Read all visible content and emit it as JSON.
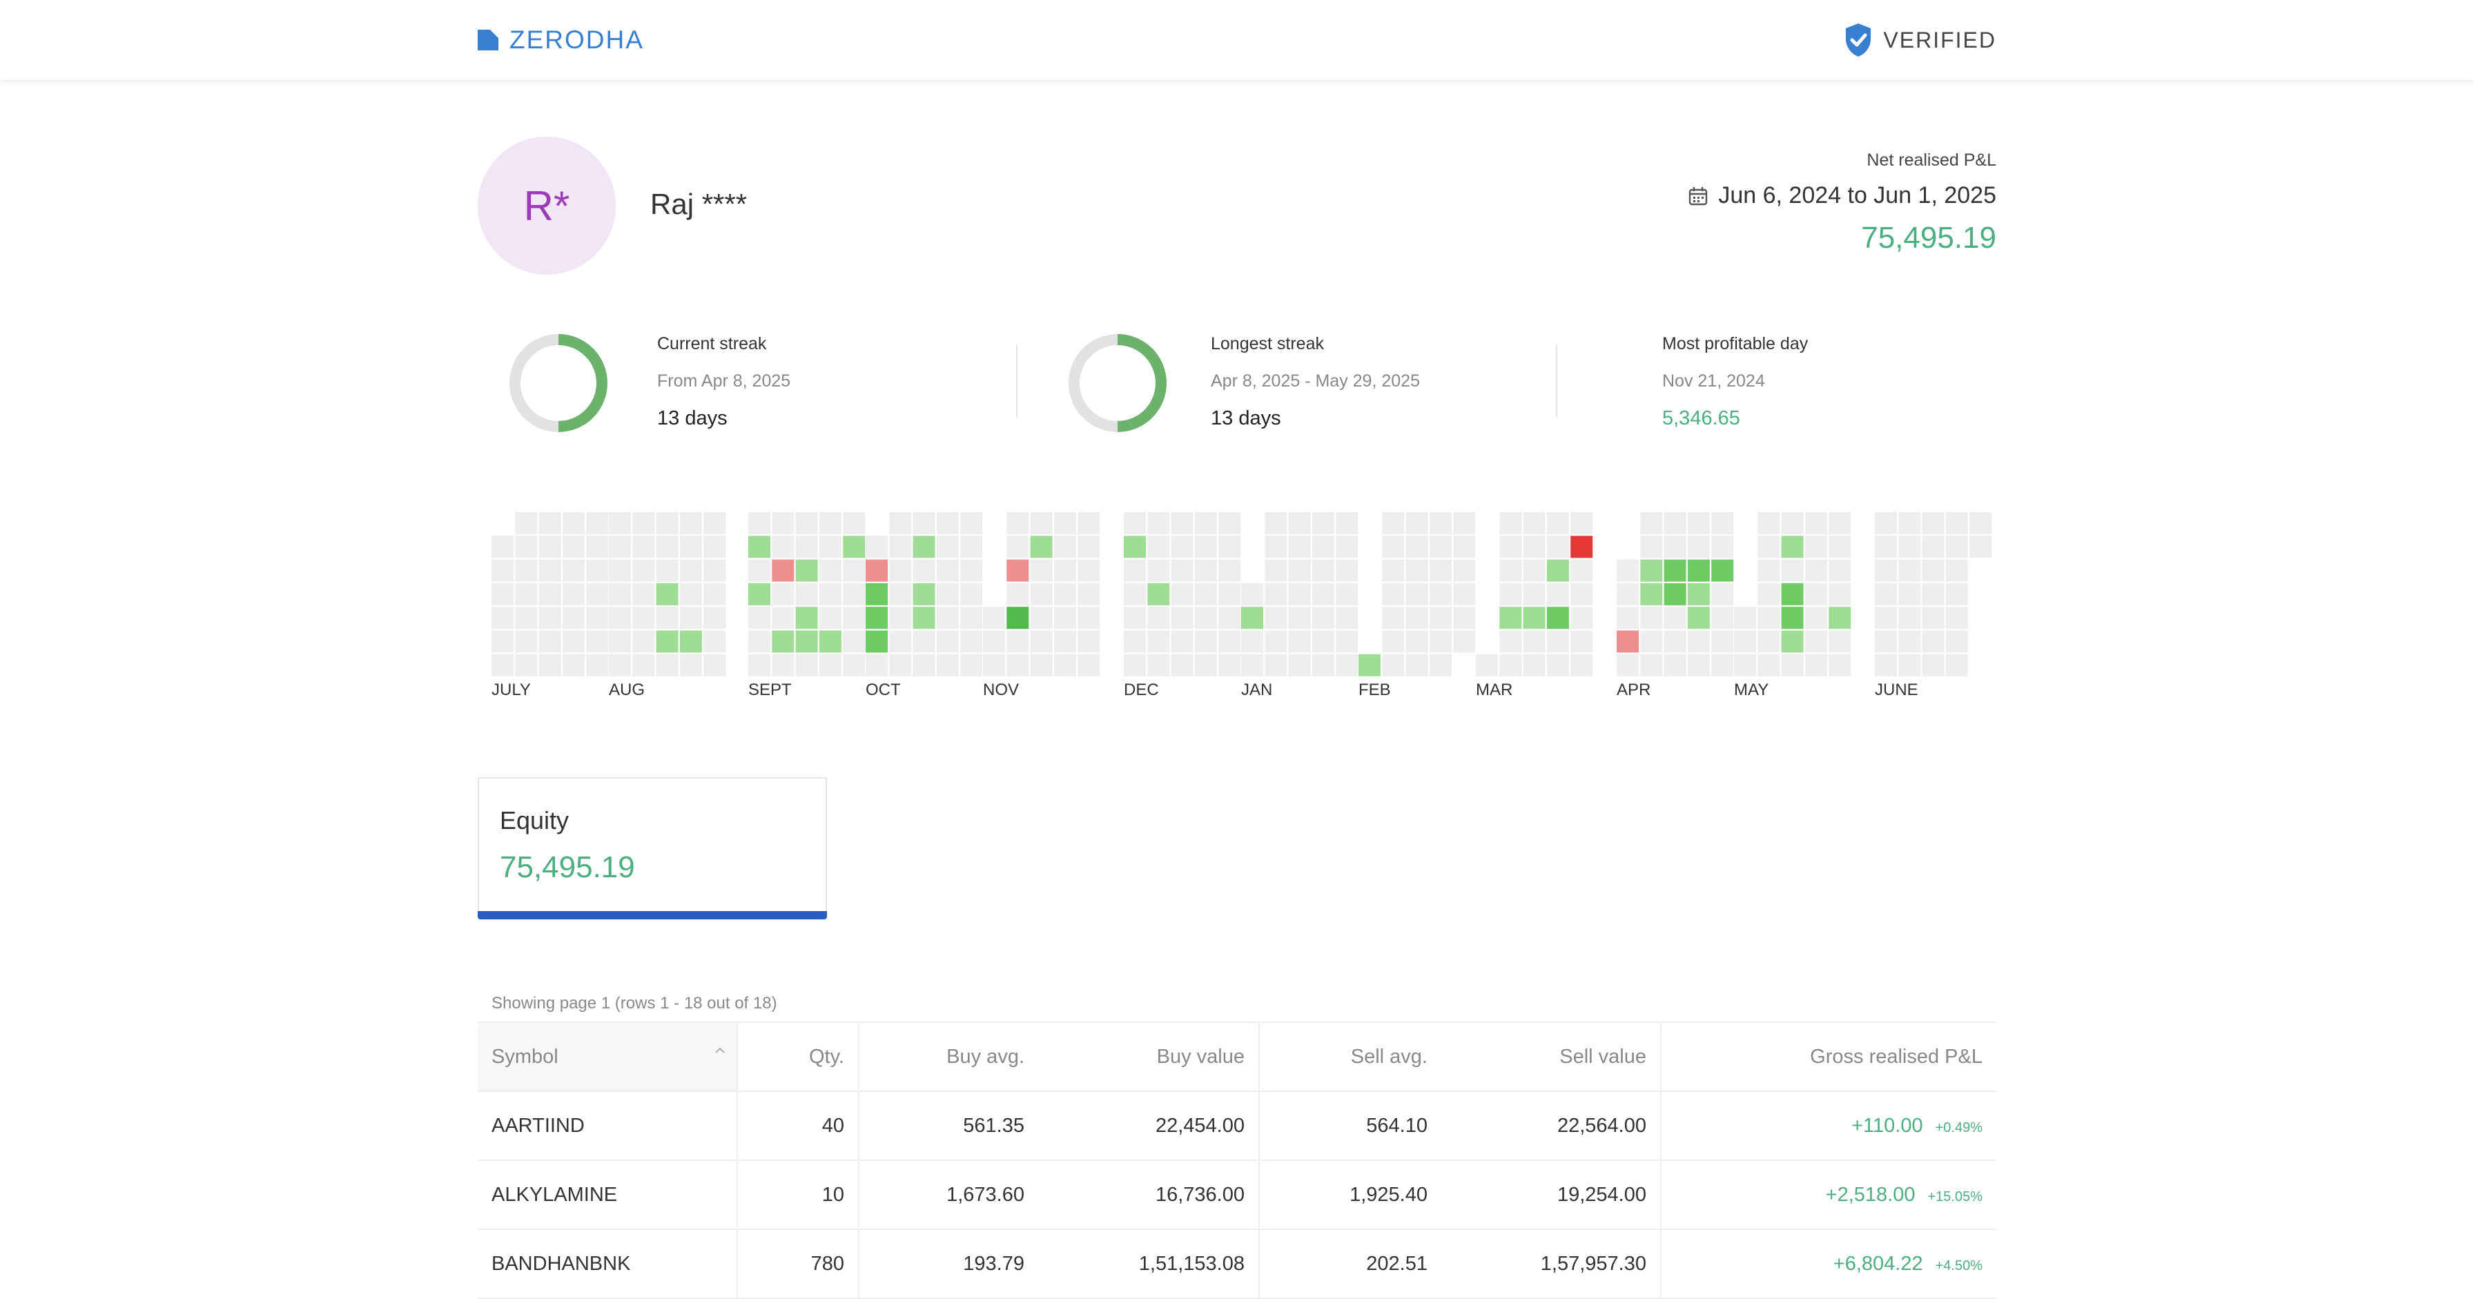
{
  "header": {
    "logo_text": "ZERODHA",
    "logo_icon": "zerodha-logo-icon",
    "verified_label": "VERIFIED",
    "verified_icon": "shield-check-icon"
  },
  "profile": {
    "avatar_initials": "R*",
    "name": "Raj ****"
  },
  "summary": {
    "label": "Net realised P&L",
    "calendar_icon": "calendar-icon",
    "date_range": "Jun 6, 2024 to Jun 1, 2025",
    "value": "75,495.19"
  },
  "stats": [
    {
      "title": "Current streak",
      "subtitle": "From Apr 8, 2025",
      "value": "13 days",
      "ring_fraction": 0.5
    },
    {
      "title": "Longest streak",
      "subtitle": "Apr 8, 2025 - May 29, 2025",
      "value": "13 days",
      "ring_fraction": 0.5
    },
    {
      "title": "Most profitable day",
      "subtitle": "Nov 21, 2024",
      "value": "5,346.65"
    }
  ],
  "heatmap": {
    "months": [
      "JULY",
      "AUG",
      "SEPT",
      "OCT",
      "NOV",
      "DEC",
      "JAN",
      "FEB",
      "MAR",
      "APR",
      "MAY",
      "JUNE"
    ],
    "colors": {
      "empty": "#eeeeee",
      "profit_light": "#9fdc94",
      "profit_mid": "#6ecb63",
      "profit_strong": "#53b94a",
      "loss_light": "#ee8e8e",
      "loss_strong": "#e53935"
    }
  },
  "segment": {
    "name": "Equity",
    "value": "75,495.19"
  },
  "table": {
    "page_info": "Showing page 1 (rows 1 - 18 out of 18)",
    "columns": [
      "Symbol",
      "Qty.",
      "Buy avg.",
      "Buy value",
      "Sell avg.",
      "Sell value",
      "Gross realised P&L"
    ],
    "sort_icon": "chevron-up-icon",
    "rows": [
      {
        "symbol": "AARTIIND",
        "qty": "40",
        "buy_avg": "561.35",
        "buy_value": "22,454.00",
        "sell_avg": "564.10",
        "sell_value": "22,564.00",
        "pnl": "+110.00",
        "pnl_pct": "+0.49%"
      },
      {
        "symbol": "ALKYLAMINE",
        "qty": "10",
        "buy_avg": "1,673.60",
        "buy_value": "16,736.00",
        "sell_avg": "1,925.40",
        "sell_value": "19,254.00",
        "pnl": "+2,518.00",
        "pnl_pct": "+15.05%"
      },
      {
        "symbol": "BANDHANBNK",
        "qty": "780",
        "buy_avg": "193.79",
        "buy_value": "1,51,153.08",
        "sell_avg": "202.51",
        "sell_value": "1,57,957.30",
        "pnl": "+6,804.22",
        "pnl_pct": "+4.50%"
      }
    ]
  }
}
